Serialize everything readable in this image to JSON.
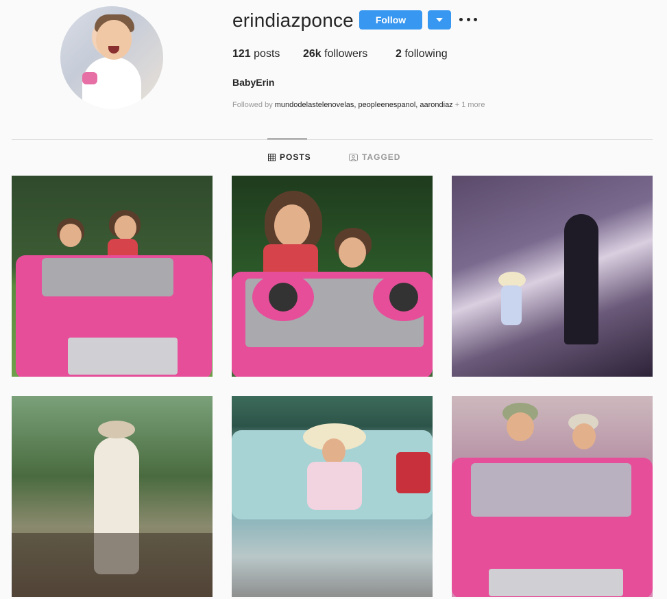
{
  "profile": {
    "username": "erindiazponce",
    "follow_label": "Follow",
    "full_name": "BabyErin"
  },
  "stats": {
    "posts_count": "121",
    "posts_label": " posts",
    "followers_count": "26k",
    "followers_label": " followers",
    "following_count": "2",
    "following_label": " following"
  },
  "followed_by": {
    "prefix": "Followed by ",
    "names": "mundodelastelenovelas, peopleenespanol, aarondiaz",
    "more": " + 1 more"
  },
  "tabs": [
    {
      "label": "POSTS",
      "icon": "grid-icon",
      "active": true
    },
    {
      "label": "TAGGED",
      "icon": "tag-icon",
      "active": false
    }
  ],
  "colors": {
    "accent": "#3897f0",
    "text": "#262626",
    "muted": "#999999",
    "background": "#fafafa"
  }
}
